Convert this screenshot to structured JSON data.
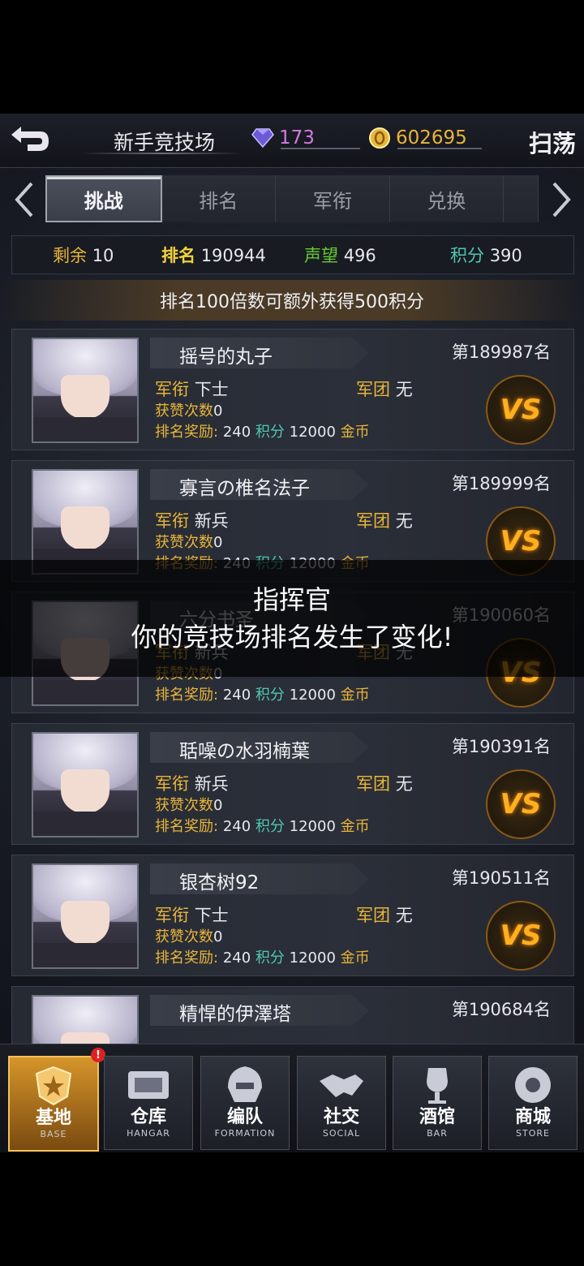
{
  "header": {
    "title": "新手竞技场",
    "gems": "173",
    "gold": "602695",
    "sweep_label": "扫荡"
  },
  "tabs": [
    {
      "label": "挑战",
      "active": true
    },
    {
      "label": "排名",
      "active": false
    },
    {
      "label": "军衔",
      "active": false
    },
    {
      "label": "兑换",
      "active": false
    }
  ],
  "stats": {
    "remaining_label": "剩余",
    "remaining_value": "10",
    "rank_label": "排名",
    "rank_value": "190944",
    "prestige_label": "声望",
    "prestige_value": "496",
    "points_label": "积分",
    "points_value": "390"
  },
  "bonus_text": "排名100倍数可额外获得500积分",
  "labels": {
    "military_rank": "军衔",
    "legion": "军团",
    "likes": "获赞次数",
    "reward": "排名奖励:",
    "points": "积分",
    "gold": "金币",
    "vs": "VS"
  },
  "opponents": [
    {
      "name": "摇号的丸子",
      "position": "第189987名",
      "mil_rank": "下士",
      "legion": "无",
      "likes": "0",
      "reward_points": "240",
      "reward_gold": "12000"
    },
    {
      "name": "寡言の椎名法子",
      "position": "第189999名",
      "mil_rank": "新兵",
      "legion": "无",
      "likes": "0",
      "reward_points": "240",
      "reward_gold": "12000"
    },
    {
      "name": "六分书圣",
      "position": "第190060名",
      "mil_rank": "新兵",
      "legion": "无",
      "likes": "0",
      "reward_points": "240",
      "reward_gold": "12000"
    },
    {
      "name": "聒噪の水羽楠葉",
      "position": "第190391名",
      "mil_rank": "新兵",
      "legion": "无",
      "likes": "0",
      "reward_points": "240",
      "reward_gold": "12000"
    },
    {
      "name": "银杏树92",
      "position": "第190511名",
      "mil_rank": "下士",
      "legion": "无",
      "likes": "0",
      "reward_points": "240",
      "reward_gold": "12000"
    },
    {
      "name": "精悍的伊澤塔",
      "position": "第190684名",
      "mil_rank": "",
      "legion": "",
      "likes": "",
      "reward_points": "",
      "reward_gold": ""
    }
  ],
  "toast": {
    "line1": "指挥官",
    "line2": "你的竞技场排名发生了变化!"
  },
  "nav": [
    {
      "label": "基地",
      "sub": "BASE",
      "active": true,
      "badge": "!"
    },
    {
      "label": "仓库",
      "sub": "HANGAR",
      "active": false
    },
    {
      "label": "编队",
      "sub": "FORMATION",
      "active": false
    },
    {
      "label": "社交",
      "sub": "SOCIAL",
      "active": false
    },
    {
      "label": "酒馆",
      "sub": "BAR",
      "active": false
    },
    {
      "label": "商城",
      "sub": "STORE",
      "active": false
    }
  ],
  "colors": {
    "accent_gold": "#e8b53a",
    "accent_teal": "#4fc8b4",
    "accent_green": "#66cc33",
    "vs_orange": "#ffb020"
  }
}
